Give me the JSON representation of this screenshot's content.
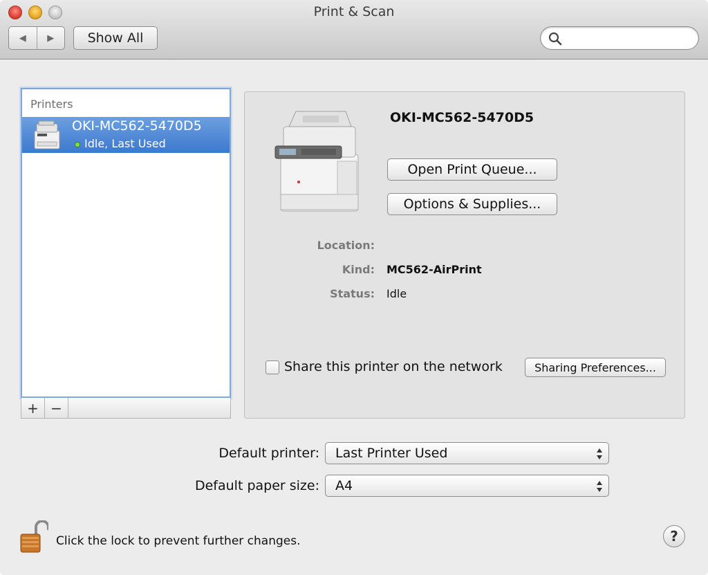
{
  "window": {
    "title": "Print & Scan"
  },
  "toolbar": {
    "back_icon": "◀",
    "forward_icon": "▶",
    "show_all_label": "Show All",
    "search_placeholder": "",
    "search_value": ""
  },
  "printers_list": {
    "header": "Printers",
    "items": [
      {
        "name": "OKI-MC562-5470D5",
        "status": "Idle, Last Used",
        "status_color": "#7ee04a"
      }
    ],
    "add_label": "+",
    "remove_label": "−"
  },
  "detail": {
    "printer_name": "OKI-MC562-5470D5",
    "open_queue_label": "Open Print Queue...",
    "options_supplies_label": "Options & Supplies...",
    "location_label": "Location:",
    "location_value": "",
    "kind_label": "Kind:",
    "kind_value": "MC562-AirPrint",
    "status_label": "Status:",
    "status_value": "Idle",
    "share_label": "Share this printer on the network",
    "share_checked": false,
    "sharing_prefs_label": "Sharing Preferences..."
  },
  "defaults": {
    "default_printer_label": "Default printer:",
    "default_printer_value": "Last Printer Used",
    "default_paper_label": "Default paper size:",
    "default_paper_value": "A4"
  },
  "footer": {
    "lock_text": "Click the lock to prevent further changes.",
    "help_label": "?"
  },
  "colors": {
    "selection_top": "#6da0e0",
    "selection_bottom": "#3d78cf",
    "window_bg": "#ececec"
  }
}
